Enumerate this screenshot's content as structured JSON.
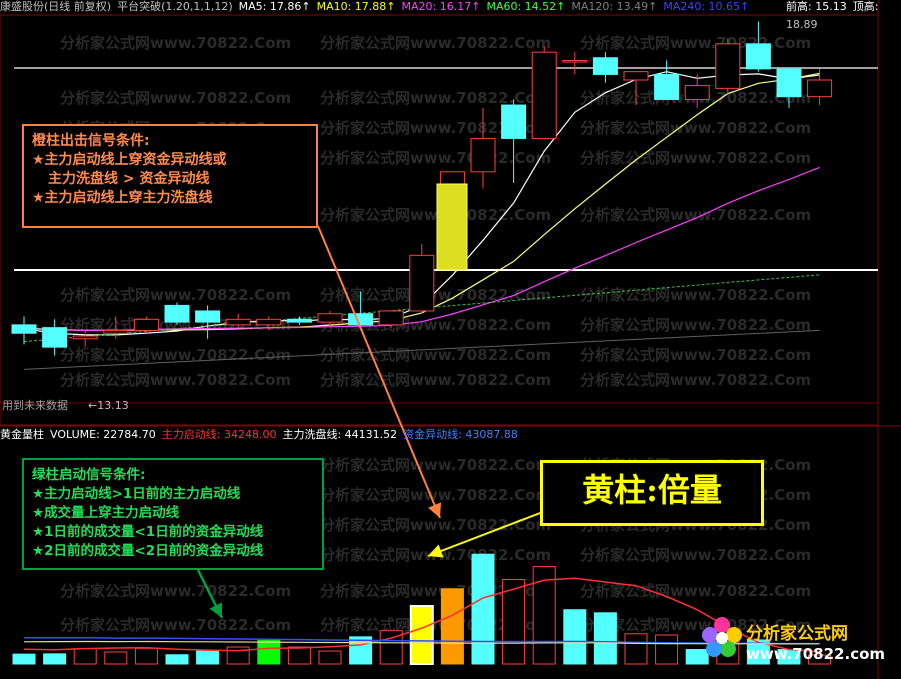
{
  "header": {
    "title": "康盛股份(日线 前复权)",
    "indicator_name": "平台突破(1.20,1,1,12)",
    "ma_items": [
      {
        "label": "MA5: 17.86",
        "color": "#ffffff"
      },
      {
        "label": "MA10: 17.88",
        "color": "#ffff00"
      },
      {
        "label": "MA20: 16.17",
        "color": "#ff40ff"
      },
      {
        "label": "MA60: 14.52",
        "color": "#40ff40"
      },
      {
        "label": "MA120: 13.49",
        "color": "#808080"
      },
      {
        "label": "MA240: 10.65",
        "color": "#4040ff"
      }
    ],
    "prev_high_label": "前高: 15.13",
    "top_label": "顶高:",
    "high_marker": "18.89",
    "low_marker": "13.13",
    "sub_label": "用到未来数据"
  },
  "volume_header": {
    "title": "黄金量柱",
    "items": [
      {
        "label": "VOLUME: 22784.70",
        "color": "#ffffff"
      },
      {
        "label": "主力启动线: 34248.00",
        "color": "#ff3030"
      },
      {
        "label": "主力洗盘线: 44131.52",
        "color": "#ffffff"
      },
      {
        "label": "资金异动线: 43087.88",
        "color": "#4080ff"
      }
    ]
  },
  "watermark": "分析家公式网www.70822.Com",
  "orange_box": {
    "title": "橙柱出击信号条件:",
    "lines": [
      "★主力启动线上穿资金异动线或",
      "主力洗盘线 > 资金异动线",
      "★主力启动线上穿主力洗盘线"
    ]
  },
  "green_box": {
    "title": "绿柱启动信号条件:",
    "lines": [
      "★主力启动线>1日前的主力启动线",
      "★成交量上穿主力启动线",
      "★1日前的成交量<1日前的资金异动线",
      "★2日前的成交量<2日前的资金异动线"
    ]
  },
  "yellow_box": {
    "label": "黄柱:倍量"
  },
  "logo": {
    "line1": "分析家公式网",
    "line2": "www.70822.com"
  },
  "colors": {
    "up": "#ff4040",
    "down": "#54ffff",
    "yellow_bar": "#ffff00",
    "orange_bar": "#ff9900",
    "green_bar": "#00ff00"
  },
  "chart_data": {
    "type": "candlestick",
    "price_ylim": [
      12.5,
      19.4
    ],
    "candles": [
      {
        "o": 13.85,
        "h": 14.0,
        "l": 13.5,
        "c": 13.7
      },
      {
        "o": 13.8,
        "h": 13.95,
        "l": 13.3,
        "c": 13.45
      },
      {
        "o": 13.6,
        "h": 13.75,
        "l": 13.45,
        "c": 13.65
      },
      {
        "o": 13.7,
        "h": 14.0,
        "l": 13.6,
        "c": 13.75
      },
      {
        "o": 13.75,
        "h": 14.0,
        "l": 13.7,
        "c": 13.95
      },
      {
        "o": 14.2,
        "h": 14.25,
        "l": 13.85,
        "c": 13.9
      },
      {
        "o": 14.1,
        "h": 14.2,
        "l": 13.6,
        "c": 13.9
      },
      {
        "o": 13.85,
        "h": 14.05,
        "l": 13.8,
        "c": 13.95
      },
      {
        "o": 13.85,
        "h": 14.0,
        "l": 13.75,
        "c": 13.95
      },
      {
        "o": 13.95,
        "h": 14.0,
        "l": 13.85,
        "c": 13.9
      },
      {
        "o": 13.9,
        "h": 14.1,
        "l": 13.8,
        "c": 14.05
      },
      {
        "o": 14.05,
        "h": 14.45,
        "l": 13.8,
        "c": 13.85
      },
      {
        "o": 13.85,
        "h": 14.1,
        "l": 13.8,
        "c": 14.1
      },
      {
        "o": 14.1,
        "h": 15.3,
        "l": 14.05,
        "c": 15.1
      },
      {
        "o": 15.1,
        "h": 16.6,
        "l": 15.1,
        "c": 16.6
      },
      {
        "o": 16.6,
        "h": 17.75,
        "l": 16.3,
        "c": 17.2
      },
      {
        "o": 17.8,
        "h": 17.9,
        "l": 16.4,
        "c": 17.2
      },
      {
        "o": 17.2,
        "h": 18.85,
        "l": 17.2,
        "c": 18.75
      },
      {
        "o": 18.6,
        "h": 18.75,
        "l": 18.35,
        "c": 18.6
      },
      {
        "o": 18.65,
        "h": 18.75,
        "l": 18.2,
        "c": 18.35
      },
      {
        "o": 18.25,
        "h": 18.4,
        "l": 17.8,
        "c": 18.4
      },
      {
        "o": 18.35,
        "h": 18.6,
        "l": 17.9,
        "c": 17.9
      },
      {
        "o": 17.9,
        "h": 18.35,
        "l": 17.75,
        "c": 18.15
      },
      {
        "o": 18.1,
        "h": 19.0,
        "l": 18.0,
        "c": 18.9
      },
      {
        "o": 18.9,
        "h": 19.3,
        "l": 18.4,
        "c": 18.45
      },
      {
        "o": 18.45,
        "h": 18.45,
        "l": 17.75,
        "c": 17.95
      },
      {
        "o": 17.95,
        "h": 18.45,
        "l": 17.8,
        "c": 18.25
      }
    ],
    "volume_ylim": [
      0,
      72000
    ],
    "volume": [
      {
        "v": 3200,
        "t": "down"
      },
      {
        "v": 3300,
        "t": "down"
      },
      {
        "v": 5000,
        "t": "up"
      },
      {
        "v": 3900,
        "t": "up"
      },
      {
        "v": 5100,
        "t": "up"
      },
      {
        "v": 3000,
        "t": "down"
      },
      {
        "v": 4200,
        "t": "down"
      },
      {
        "v": 5500,
        "t": "up"
      },
      {
        "v": 7600,
        "t": "green"
      },
      {
        "v": 5500,
        "t": "up"
      },
      {
        "v": 4200,
        "t": "up"
      },
      {
        "v": 8800,
        "t": "down"
      },
      {
        "v": 10800,
        "t": "up"
      },
      {
        "v": 18800,
        "t": "yellow"
      },
      {
        "v": 24400,
        "t": "orange"
      },
      {
        "v": 35600,
        "t": "down"
      },
      {
        "v": 27400,
        "t": "up"
      },
      {
        "v": 31600,
        "t": "up"
      },
      {
        "v": 17600,
        "t": "down"
      },
      {
        "v": 16600,
        "t": "down"
      },
      {
        "v": 9800,
        "t": "up"
      },
      {
        "v": 9400,
        "t": "up"
      },
      {
        "v": 4700,
        "t": "down"
      },
      {
        "v": 10800,
        "t": "up"
      },
      {
        "v": 7800,
        "t": "down"
      },
      {
        "v": 4700,
        "t": "down"
      },
      {
        "v": 2900,
        "t": "up"
      }
    ],
    "series": [
      {
        "name": "主力启动线",
        "color": "#ff3030",
        "values": [
          4800,
          4600,
          5000,
          5200,
          5300,
          4800,
          4500,
          4300,
          5100,
          5200,
          5600,
          6200,
          8400,
          11600,
          15800,
          21400,
          24300,
          27200,
          27800,
          26600,
          25400,
          21900,
          17600,
          11900,
          7000,
          4700,
          4000
        ]
      },
      {
        "name": "资金异动线",
        "color": "#3050ff",
        "values": [
          8500,
          8500,
          8500,
          8400,
          8400,
          8300,
          8200,
          8100,
          8000,
          7900,
          7800,
          7700,
          7600,
          7500,
          7400,
          7300,
          7300,
          7300,
          7300,
          7200,
          7000,
          6900,
          6800,
          6700,
          6700,
          6600,
          6600
        ]
      }
    ]
  }
}
